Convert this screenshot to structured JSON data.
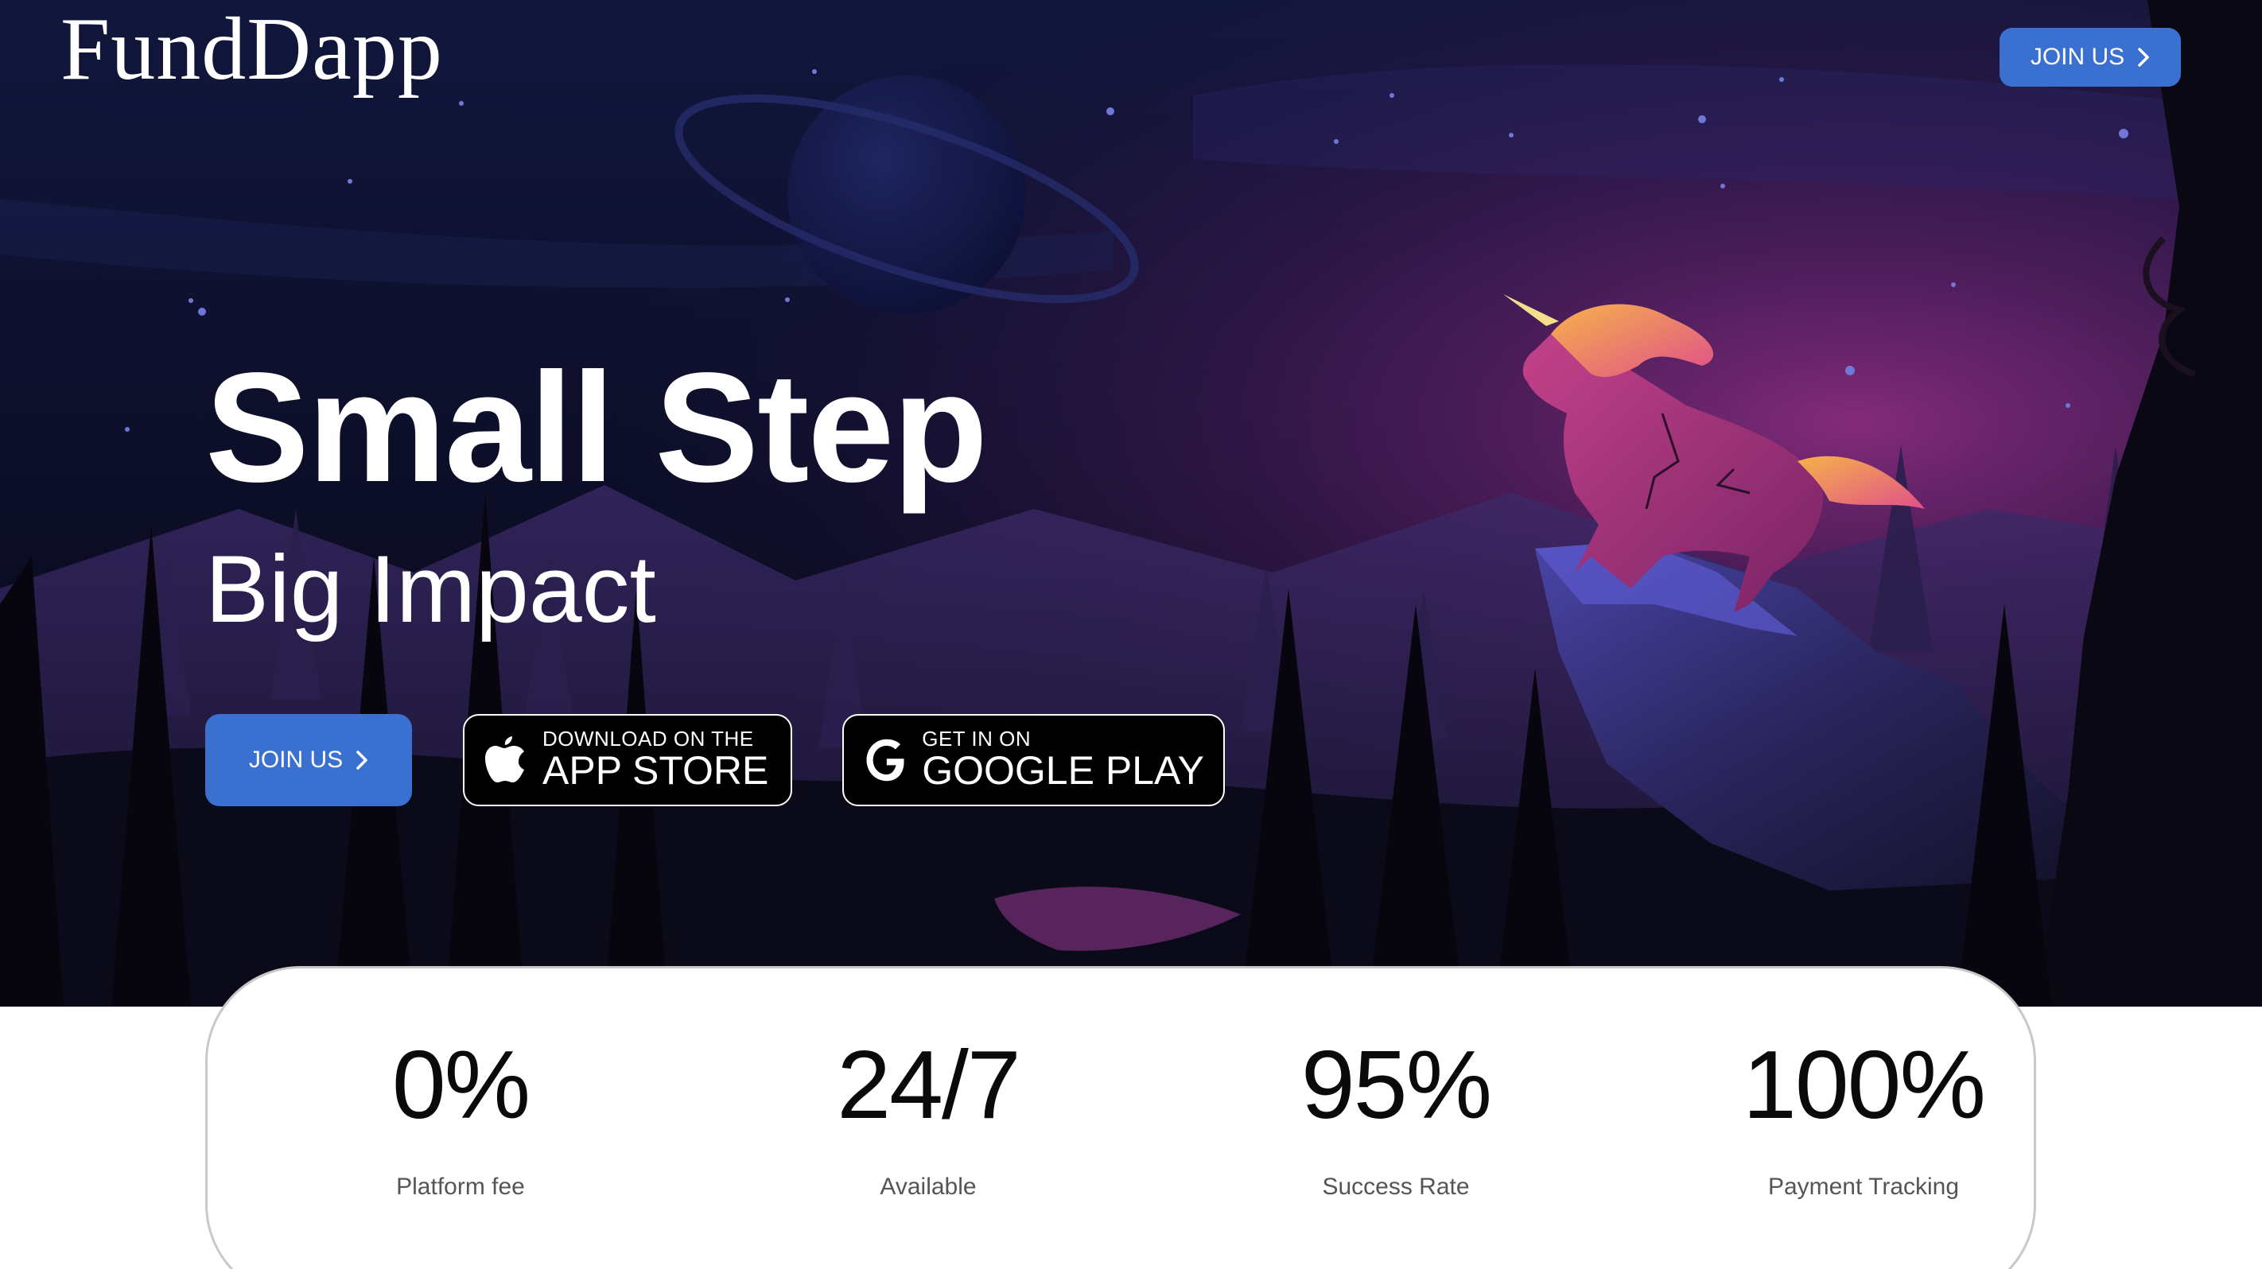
{
  "header": {
    "logo": "FundDapp",
    "join_label": "JOIN US"
  },
  "hero": {
    "title": "Small Step",
    "subtitle": "Big Impact",
    "join_label": "JOIN US",
    "app_store": {
      "small": "DOWNLOAD ON THE",
      "big": "APP STORE",
      "icon": "apple-icon"
    },
    "google_play": {
      "small": "GET IN ON",
      "big": "GOOGLE PLAY",
      "icon": "google-icon"
    }
  },
  "stats": [
    {
      "value": "0%",
      "label": "Platform fee"
    },
    {
      "value": "24/7",
      "label": "Available"
    },
    {
      "value": "95%",
      "label": "Success Rate"
    },
    {
      "value": "100%",
      "label": "Payment Tracking"
    }
  ],
  "colors": {
    "accent": "#3a70d0",
    "sky_top": "#12173e",
    "sky_glow": "#7a2a78",
    "unicorn": "#b8367e"
  }
}
